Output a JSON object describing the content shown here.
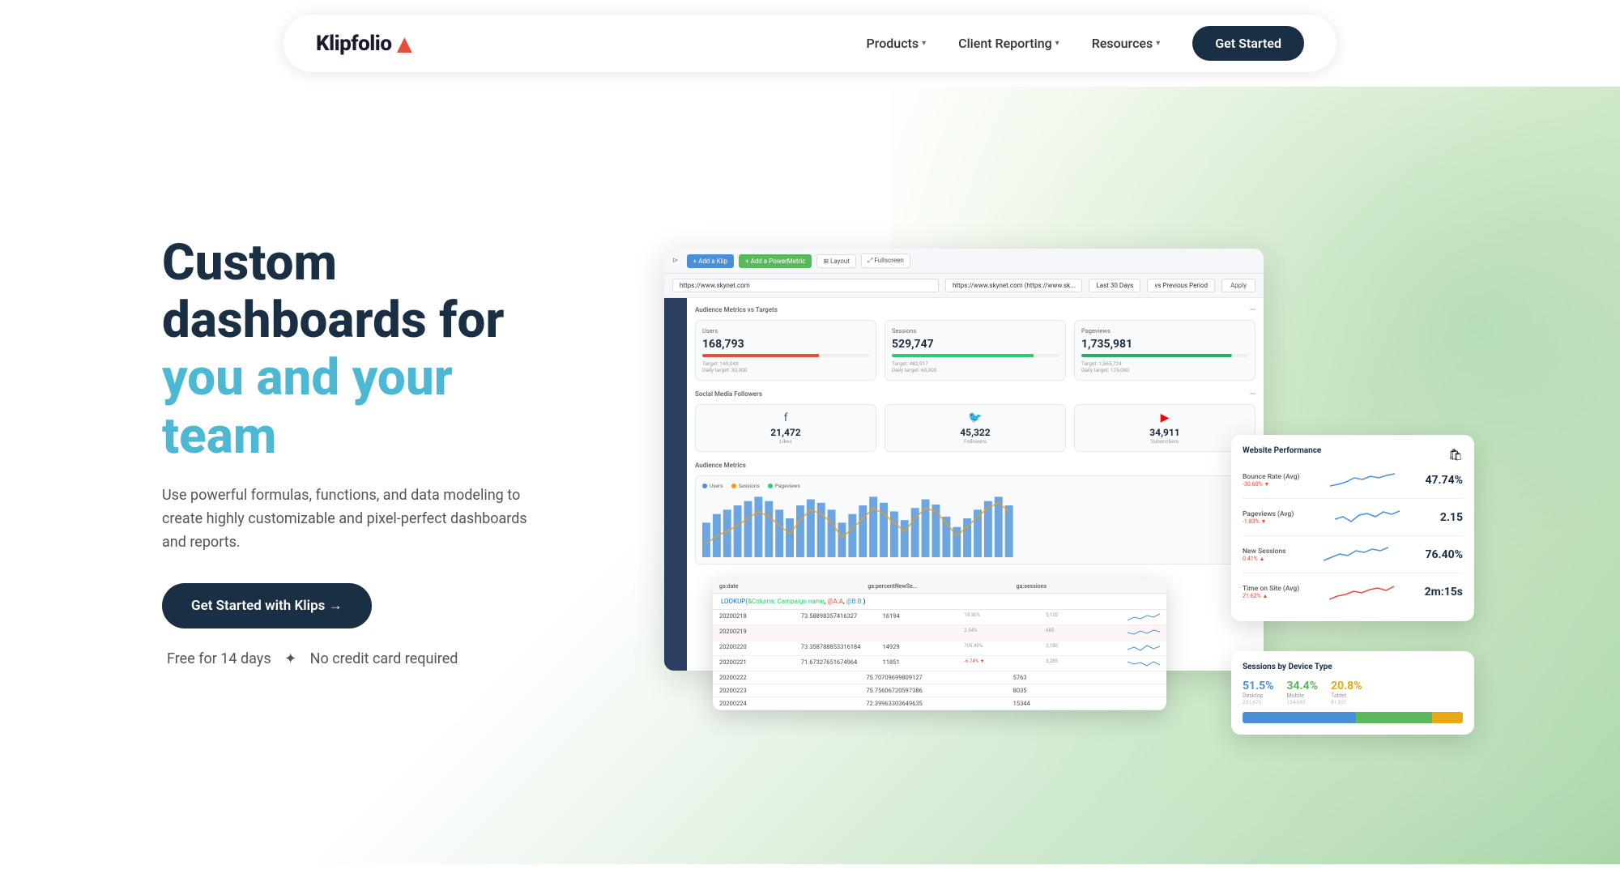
{
  "nav": {
    "logo": "Klipfolio",
    "logo_accent": "▲",
    "links": [
      {
        "id": "products",
        "label": "Products",
        "hasChevron": true
      },
      {
        "id": "client-reporting",
        "label": "Client Reporting",
        "hasChevron": true
      },
      {
        "id": "resources",
        "label": "Resources",
        "hasChevron": true
      }
    ],
    "cta": "Get Started"
  },
  "hero": {
    "heading_line1": "Custom",
    "heading_line2": "dashboards for",
    "heading_highlight": "you and your",
    "heading_line4": "team",
    "subtext": "Use powerful formulas, functions, and data modeling to create highly customizable and pixel-perfect dashboards and reports.",
    "cta_label": "Get Started with Klips →",
    "cta_note_free": "Free for 14 days",
    "cta_note_separator": "✦",
    "cta_note_no_cc": "No credit card required"
  },
  "dashboard": {
    "toolbar": {
      "btn1": "+ Add a Klip",
      "btn2": "+ Add a PowerMetric",
      "btn3": "⊞ Layout",
      "btn4": "⤢ Fullscreen"
    },
    "url": "https://www.skynet.com",
    "url_full": "https://www.skynet.com (https://www.sk...",
    "period1": "Last 30 Days",
    "period2": "vs Previous Period",
    "apply": "Apply",
    "audience_section": "Audience Metrics vs Targets",
    "metrics": [
      {
        "label": "Users",
        "value": "168,793",
        "target": "Target: 169,043",
        "daily": "Daily target: 30,000",
        "bar_type": "red"
      },
      {
        "label": "Sessions",
        "value": "529,747",
        "target": "Target: 482,917",
        "daily": "Daily target: 60,000",
        "bar_type": "green"
      },
      {
        "label": "Pageviews",
        "value": "1,735,981",
        "target": "Target: 1,565,724",
        "daily": "Daily target: 125,000",
        "bar_type": "dark-green"
      }
    ],
    "social_section": "Social Media Followers",
    "social": [
      {
        "label": "Facebook",
        "icon": "f",
        "value": "21,472",
        "sublabel": "Likes"
      },
      {
        "label": "Twitter",
        "icon": "🐦",
        "value": "45,322",
        "sublabel": "Followers"
      },
      {
        "label": "YouTube",
        "icon": "▶",
        "value": "34,911",
        "sublabel": "Subscribers"
      }
    ],
    "audience_metrics_section": "Audience Metrics",
    "chart_legend": [
      "Users",
      "Sessions",
      "Pageviews"
    ],
    "website_perf": {
      "title": "Website Performance",
      "rows": [
        {
          "label": "Bounce Rate (Avg)",
          "value": "47.74%",
          "change": "-30.60% ▼",
          "pos": false
        },
        {
          "label": "Pageviews (Avg)",
          "value": "2.15",
          "change": "-1.83% ▼",
          "pos": false
        },
        {
          "label": "New Sessions",
          "value": "76.40%",
          "change": "0.41% ▲",
          "pos": true
        },
        {
          "label": "Time on Site (Avg)",
          "value": "2m:15s",
          "change": "21.62% ▲",
          "pos": true
        }
      ]
    },
    "sessions_device": {
      "title": "Sessions by Device Type",
      "desktop": {
        "pct": "51.5%",
        "count": "231,670"
      },
      "mobile": {
        "pct": "34.4%",
        "count": "134,693"
      },
      "tablet": {
        "pct": "20.8%",
        "count": "81,521"
      },
      "bar_blue": 50,
      "bar_green": 33,
      "bar_orange": 17
    },
    "spreadsheet": {
      "formula": "LOOKUP(&Column: Campaign name, @A:A, @B:B)",
      "cols": [
        "ga:date",
        "ga:percentNewSe...",
        "ga:sessions"
      ],
      "rows": [
        [
          "20200218",
          "73.58898357416327",
          "16194"
        ],
        [
          "20200219",
          "",
          ""
        ],
        [
          "20200220",
          "73.358788853316184",
          "14929"
        ],
        [
          "20200221",
          "71.67327651674964",
          "11851"
        ],
        [
          "20200222",
          "75.70709699809127",
          "5763"
        ],
        [
          "20200223",
          "75.7560672059738​6",
          "8035"
        ],
        [
          "20200224",
          "72.39963303649635",
          "15344"
        ]
      ]
    }
  },
  "colors": {
    "brand_dark": "#1a2e44",
    "brand_teal": "#4db8d4",
    "cta_bg": "#1a2e44",
    "accent_red": "#e74c3c",
    "accent_green": "#2ecc71",
    "accent_blue": "#4a90d9",
    "nav_bg": "#ffffff"
  }
}
